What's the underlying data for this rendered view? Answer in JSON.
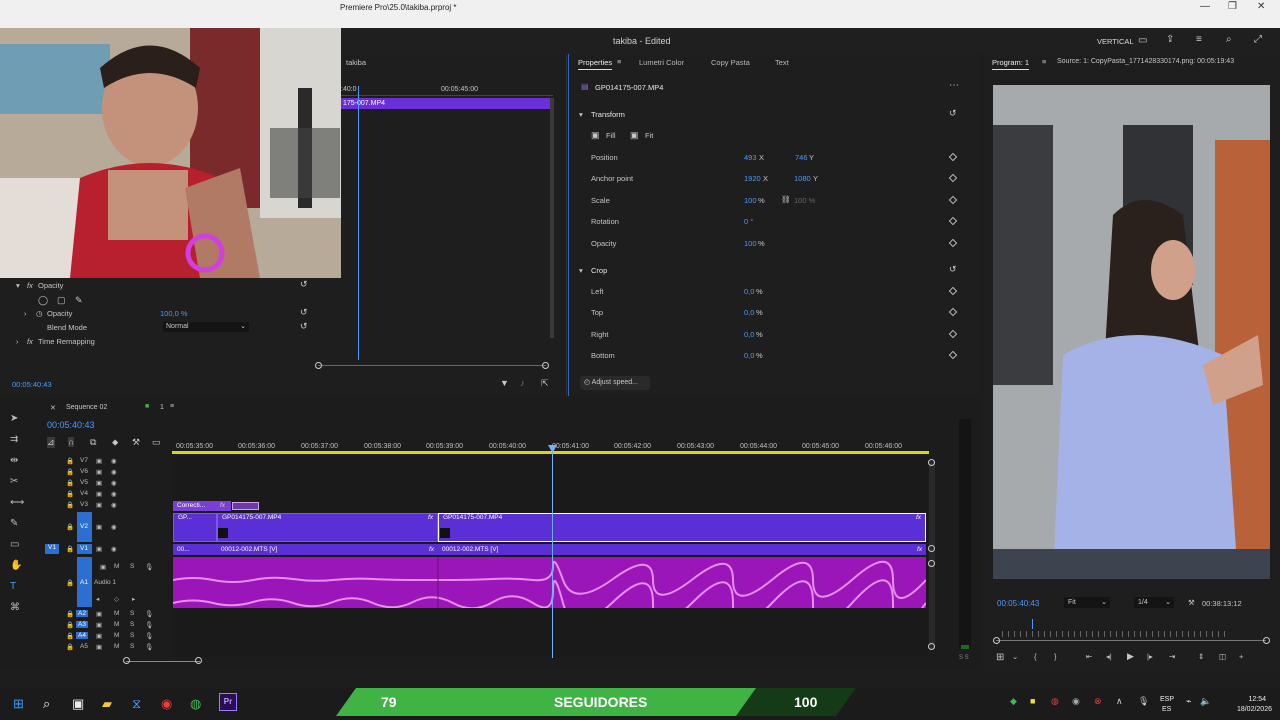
{
  "window": {
    "title": "Premiere Pro\\25.0\\takiba.prproj *",
    "minimize": "—",
    "maximize": "❐",
    "close": "✕"
  },
  "header": {
    "project_title": "takiba",
    "status": "- Edited",
    "mode": "VERTICAL"
  },
  "effect_controls": {
    "clip_tab": "takiba",
    "ruler_time": "00:05:45:00",
    "ruler_time_left": ":40:0",
    "clip_label": "175-007.MP4",
    "opacity_section": "Opacity",
    "opacity_label": "Opacity",
    "opacity_value": "100,0 %",
    "blend_mode_label": "Blend Mode",
    "blend_mode_value": "Normal",
    "time_remapping": "Time Remapping",
    "current_time": "00:05:40:43"
  },
  "properties": {
    "tabs": [
      "Properties",
      "Lumetri Color",
      "Copy Pasta",
      "Text"
    ],
    "clip_name": "GP014175-007.MP4",
    "transform_label": "Transform",
    "fill_label": "Fill",
    "fit_label": "Fit",
    "position_label": "Position",
    "position_x": "493",
    "position_y": "746",
    "anchor_label": "Anchor point",
    "anchor_x": "1920",
    "anchor_y": "1080",
    "scale_label": "Scale",
    "scale_value": "100",
    "scale_linked": "100 %",
    "rotation_label": "Rotation",
    "rotation_value": "0 °",
    "opacity_label": "Opacity",
    "opacity_value": "100",
    "crop_label": "Crop",
    "left_label": "Left",
    "top_label": "Top",
    "right_label": "Right",
    "bottom_label": "Bottom",
    "crop_value": "0,0",
    "adjust_speed": "Adjust speed...",
    "unit_x": "X",
    "unit_y": "Y",
    "unit_pct": "%"
  },
  "program": {
    "tab": "Program: 1",
    "source": "Source: 1: CopyPasta_1771428330174.png: 00:05:19:43",
    "timecode": "00:05:40:43",
    "fit": "Fit",
    "resolution": "1/4",
    "duration": "00:38:13:12"
  },
  "timeline": {
    "sequence": "Sequence 02",
    "sequence_num": "1",
    "timecode": "00:05:40:43",
    "ruler": [
      "00:05:35:00",
      "00:05:36:00",
      "00:05:37:00",
      "00:05:38:00",
      "00:05:39:00",
      "00:05:40:00",
      "00:05:41:00",
      "00:05:42:00",
      "00:05:43:00",
      "00:05:44:00",
      "00:05:45:00",
      "00:05:46:00"
    ],
    "tracks": [
      "V7",
      "V6",
      "V5",
      "V4",
      "V3",
      "V2",
      "V1",
      "A1",
      "A2",
      "A3",
      "A4",
      "A5"
    ],
    "v1_source": "V1",
    "audio1_name": "Audio 1",
    "clips": {
      "v3_clip": "Correcti...",
      "v2_clip_a_short": "GP...",
      "v2_clip_a": "GP014175-007.MP4",
      "v2_clip_b": "GP014175-007.MP4",
      "v1_clip_short": "00...",
      "v1_clip_a": "00012-002.MTS [V]",
      "v1_clip_b": "00012-002.MTS [V]"
    },
    "fx": "fx",
    "mute": "M",
    "solo": "S",
    "meter_label": "S S"
  },
  "taskbar": {
    "followers_current": "79",
    "followers_label": "SEGUIDORES",
    "followers_goal": "100",
    "lang_top": "ESP",
    "lang_bottom": "ES",
    "time": "12:54",
    "date": "18/02/2026"
  },
  "colors": {
    "accent": "#2e8bff",
    "video_clip": "#5a2fd6",
    "audio_clip": "#9b16b8",
    "playhead": "#6fb2ff",
    "work_area": "#d9d51c",
    "goal_bar": "#3fb444"
  }
}
